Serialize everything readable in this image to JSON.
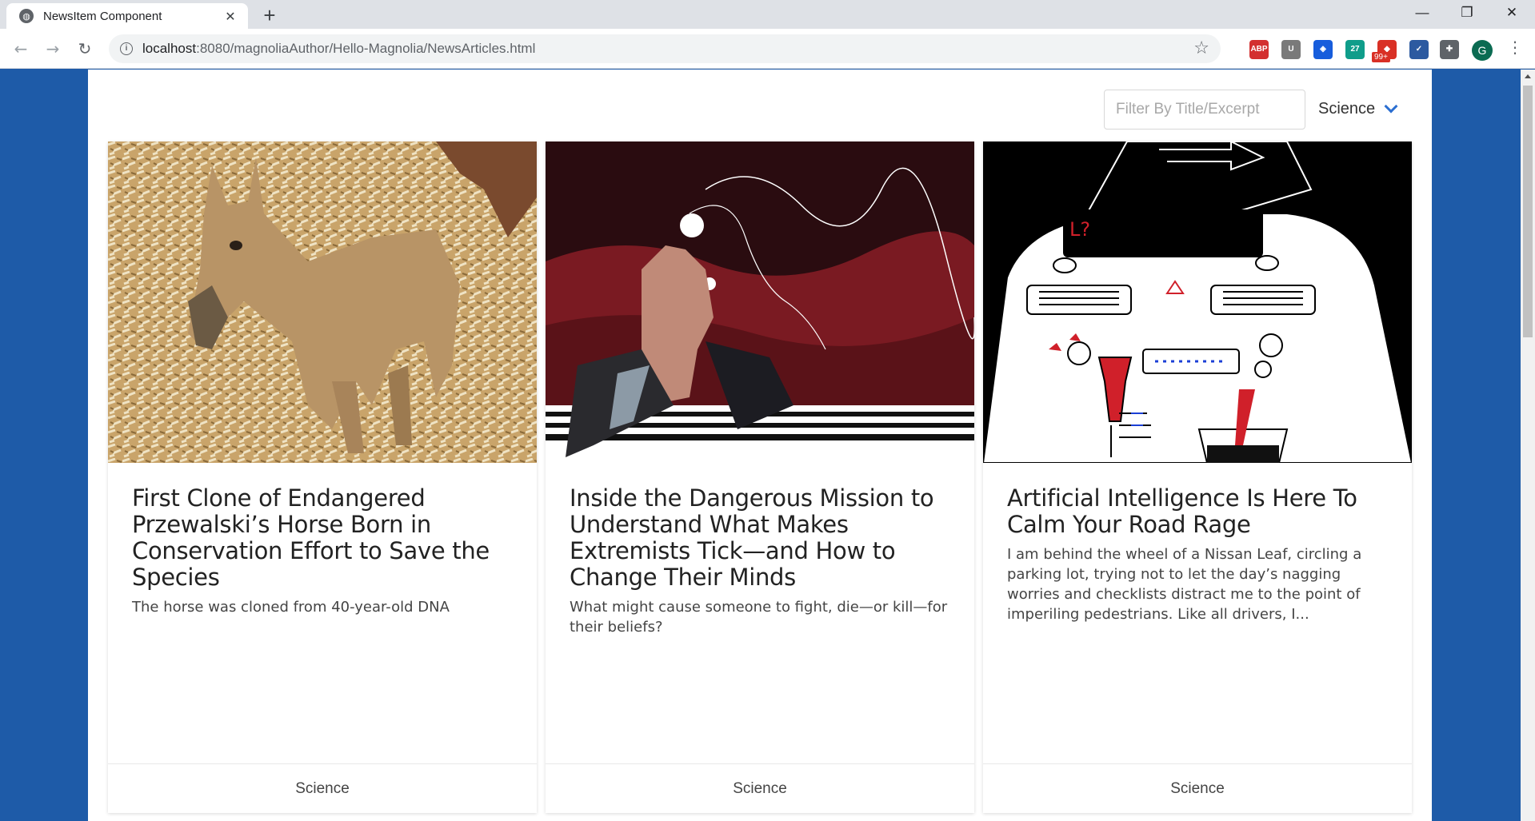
{
  "browser": {
    "tab_title": "NewsItem Component",
    "tab_close": "✕",
    "new_tab": "+",
    "url_host": "localhost",
    "url_path": ":8080/magnoliaAuthor/Hello-Magnolia/NewsArticles.html",
    "window_min": "—",
    "window_restore": "❐",
    "window_close": "✕",
    "extensions": [
      {
        "name": "adblock-plus-icon",
        "label": "ABP",
        "color": "#d32f2f"
      },
      {
        "name": "u-extension-icon",
        "label": "U",
        "color": "#7a7a7a"
      },
      {
        "name": "bitwarden-icon",
        "label": "◈",
        "color": "#175ddc"
      },
      {
        "name": "calendar-extension-icon",
        "label": "27",
        "color": "#0f9d8a"
      },
      {
        "name": "todoist-icon",
        "label": "◆",
        "color": "#d93025"
      },
      {
        "name": "checklist-icon",
        "label": "✓",
        "color": "#2c5aa0"
      },
      {
        "name": "extensions-puzzle-icon",
        "label": "✚",
        "color": "#5f6368"
      }
    ],
    "ext_badge": "99+",
    "avatar_initial": "G"
  },
  "filter": {
    "placeholder": "Filter By Title/Excerpt",
    "category": "Science"
  },
  "cards": [
    {
      "title": "First Clone of Endangered Przewalski’s Horse Born in Conservation Effort to Save the Species",
      "excerpt": "The horse was cloned from 40-year-old DNA",
      "category": "Science"
    },
    {
      "title": "Inside the Dangerous Mission to Understand What Makes Extremists Tick—and How to Change Their Minds",
      "excerpt": "What might cause someone to fight, die—or kill—for their beliefs?",
      "category": "Science"
    },
    {
      "title": "Artificial Intelligence Is Here To Calm Your Road Rage",
      "excerpt": "I am behind the wheel of a Nissan Leaf, circling a parking lot, trying not to let the day’s nagging worries and checklists distract me to the point of imperiling pedestrians. Like all drivers, I...",
      "category": "Science"
    }
  ],
  "colors": {
    "page_background": "#1e5ba8",
    "accent": "#2c6fd1"
  }
}
